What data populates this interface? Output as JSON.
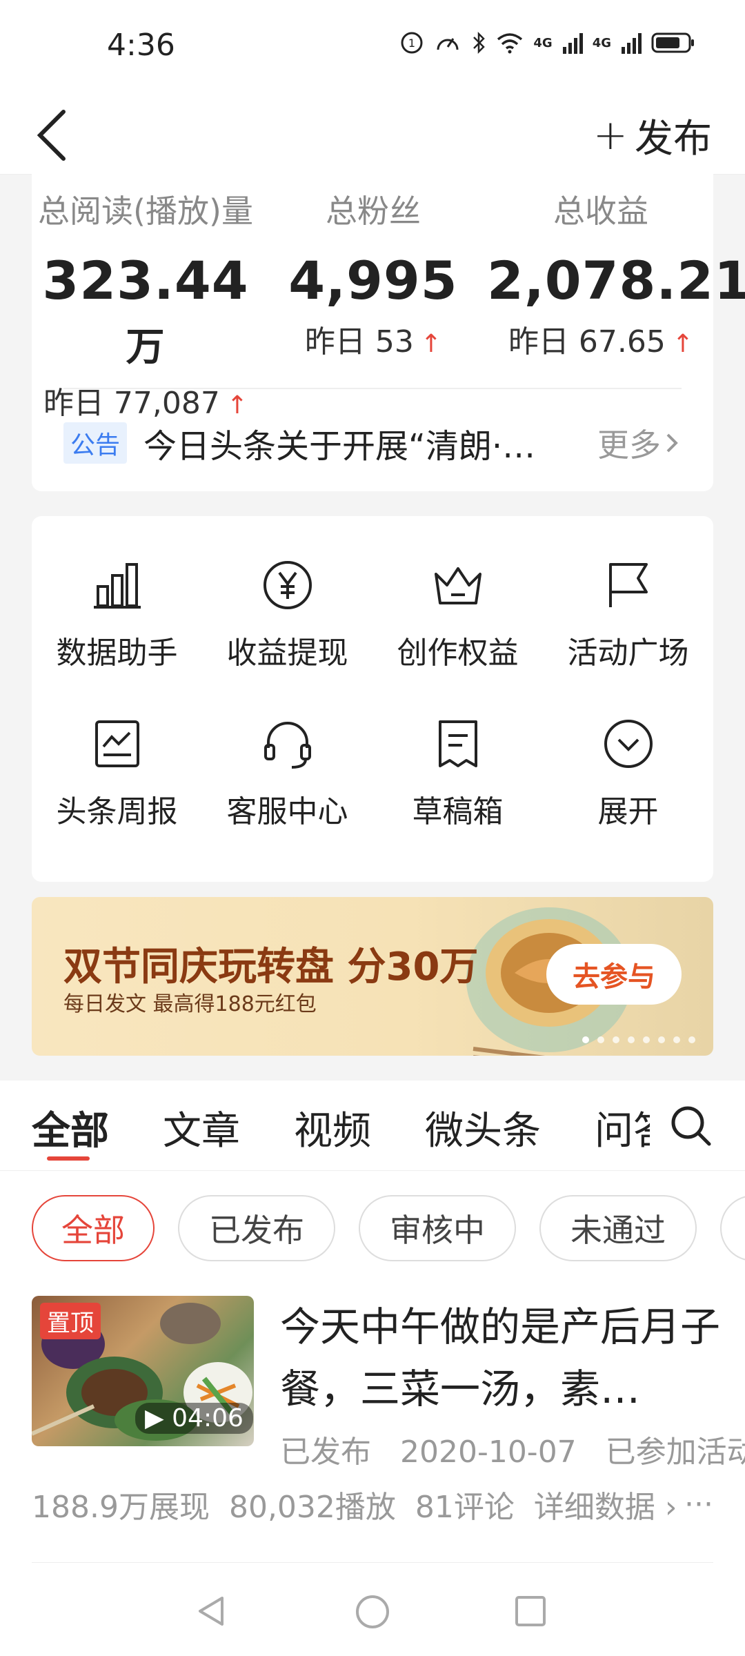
{
  "status_bar": {
    "time": "4:36",
    "net1": "4G",
    "net2": "4G"
  },
  "nav": {
    "publish_label": "发布"
  },
  "stats": [
    {
      "label": "总阅读(播放)量",
      "value": "323.44",
      "unit": "万",
      "yesterday": "昨日 77,087"
    },
    {
      "label": "总粉丝",
      "value": "4,995",
      "unit": "",
      "yesterday": "昨日 53"
    },
    {
      "label": "总收益",
      "value": "2,078.21",
      "unit": "",
      "yesterday": "昨日 67.65"
    }
  ],
  "notice": {
    "tag": "公告",
    "text": "今日头条关于开展“清朗·…",
    "more": "更多"
  },
  "tools": [
    {
      "label": "数据助手",
      "icon": "bar-chart-icon"
    },
    {
      "label": "收益提现",
      "icon": "yuan-coin-icon"
    },
    {
      "label": "创作权益",
      "icon": "crown-icon"
    },
    {
      "label": "活动广场",
      "icon": "flag-icon"
    },
    {
      "label": "头条周报",
      "icon": "report-icon"
    },
    {
      "label": "客服中心",
      "icon": "headset-icon"
    },
    {
      "label": "草稿箱",
      "icon": "draft-icon"
    },
    {
      "label": "展开",
      "icon": "chevron-down-circle-icon"
    }
  ],
  "banner": {
    "title": "双节同庆玩转盘 分30万",
    "subtitle": "每日发文 最高得188元红包",
    "button": "去参与"
  },
  "tabs": [
    "全部",
    "文章",
    "视频",
    "微头条",
    "问答"
  ],
  "filters": [
    "全部",
    "已发布",
    "审核中",
    "未通过"
  ],
  "post": {
    "pin": "置顶",
    "duration": "04:06",
    "title": "今天中午做的是产后月子餐，三菜一汤，素…",
    "status": "已发布",
    "date": "2020-10-07",
    "activity": "已参加活动",
    "impressions": "188.9万展现",
    "plays": "80,032播放",
    "comments": "81评论",
    "detail": "详细数据"
  },
  "colors": {
    "accent": "#e5453a",
    "notice_blue": "#3b7cf0",
    "banner_text": "#8a3a12"
  }
}
